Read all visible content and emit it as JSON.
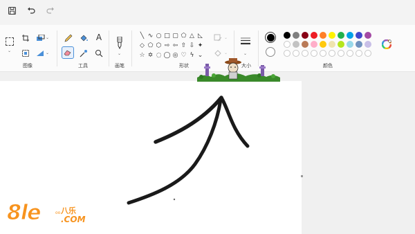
{
  "titlebar": {
    "save_icon": "save-icon",
    "undo_icon": "undo-icon",
    "redo_icon": "redo-icon"
  },
  "ribbon": {
    "groups": {
      "image": "图像",
      "tools": "工具",
      "brushes": "画笔",
      "shapes": "形状",
      "size": "大小",
      "colors": "颜色"
    },
    "text_tool_glyph": "A"
  },
  "colors": {
    "primary": "#000000",
    "secondary": "#ffffff",
    "row1": [
      "#000000",
      "#7f7f7f",
      "#880015",
      "#ed1c24",
      "#ff7f27",
      "#fff200",
      "#22b14c",
      "#00a2e8",
      "#3f48cc",
      "#a349a4"
    ],
    "row2": [
      "#ffffff",
      "#c3c3c3",
      "#b97a57",
      "#ffaec9",
      "#ffc90e",
      "#efe4b0",
      "#b5e61d",
      "#99d9ea",
      "#7092be",
      "#c8bfe7"
    ],
    "row3_count": 10,
    "accent": "#4a90d9"
  },
  "watermark": {
    "brand": "8le",
    "superscript": "oo",
    "cn_text": "八乐",
    "domain": ".COM"
  }
}
